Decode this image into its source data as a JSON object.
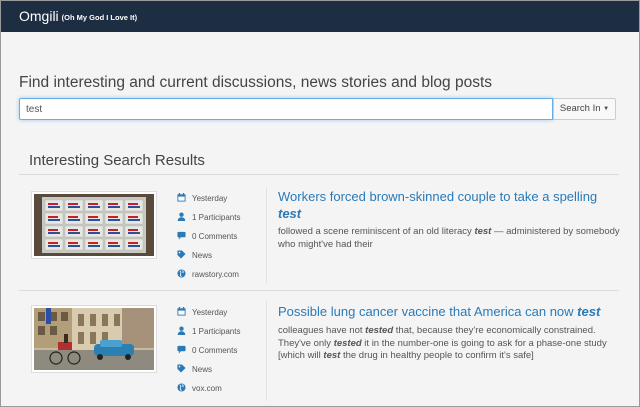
{
  "navbar": {
    "brand": "Omgili",
    "tagline": "(Oh My God I Love It)"
  },
  "hero": {
    "title": "Find interesting and current discussions, news stories and blog posts"
  },
  "search": {
    "value": "test",
    "button_label": "Search In"
  },
  "section": {
    "title": "Interesting Search Results"
  },
  "results": [
    {
      "date": "Yesterday",
      "participants": "1 Participants",
      "comments": "0 Comments",
      "type": "News",
      "source": "rawstory.com",
      "title_pre": "Workers forced brown-skinned couple to take a spelling ",
      "title_kw": "test",
      "snip_a": "followed a scene reminiscent of an old literacy ",
      "snip_b": "test",
      "snip_c": " — administered by somebody who might've had their"
    },
    {
      "date": "Yesterday",
      "participants": "1 Participants",
      "comments": "0 Comments",
      "type": "News",
      "source": "vox.com",
      "title_pre": "Possible lung cancer vaccine that America can now ",
      "title_kw": "test",
      "snip_a": "colleagues have not ",
      "snip_b": "tested",
      "snip_c": " that, because they're economically constrained. They've only ",
      "snip_d": "tested",
      "snip_e": " it in the number-one is going to ask for a phase-one study [which will ",
      "snip_f": "test",
      "snip_g": " the drug in healthy people to confirm it's safe]"
    }
  ],
  "icons": {
    "accent": "#2a7ab8",
    "calendar": "calendar-icon",
    "user": "user-icon",
    "comment": "comment-icon",
    "tag": "tag-icon",
    "globe": "globe-icon"
  }
}
